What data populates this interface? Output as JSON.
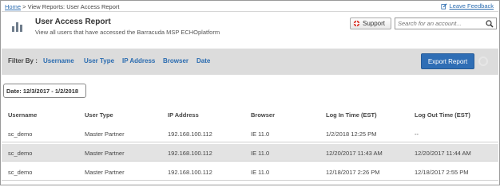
{
  "breadcrumb": {
    "home": "Home",
    "separator": " > ",
    "current": "View Reports: User Access Report"
  },
  "feedback": {
    "label": "Leave Feedback",
    "icon": "edit-icon"
  },
  "header": {
    "icon": "bar-chart-icon",
    "title": "User Access Report",
    "subtitle": "View all users that have accessed the Barracuda MSP ECHOplatform"
  },
  "support": {
    "label": "Support",
    "icon": "lifebuoy-icon"
  },
  "search": {
    "placeholder": "Search for an account...",
    "value": "",
    "icon": "search-icon"
  },
  "filter": {
    "label": "Filter By :",
    "options": [
      "Username",
      "User Type",
      "IP Address",
      "Browser",
      "Date"
    ]
  },
  "export": {
    "label": "Export Report"
  },
  "date_range": {
    "label": "Date: 12/3/2017 - 1/2/2018"
  },
  "table": {
    "columns": [
      "Username",
      "User Type",
      "IP Address",
      "Browser",
      "Log In Time (EST)",
      "Log Out Time (EST)"
    ],
    "rows": [
      [
        "sc_demo",
        "Master Partner",
        "192.168.100.112",
        "IE 11.0",
        "1/2/2018 12:25 PM",
        "--"
      ],
      [
        "sc_demo",
        "Master Partner",
        "192.168.100.112",
        "IE 11.0",
        "12/20/2017 11:43 AM",
        "12/20/2017 11:44 AM"
      ],
      [
        "sc_demo",
        "Master Partner",
        "192.168.100.112",
        "IE 11.0",
        "12/18/2017 2:26 PM",
        "12/18/2017 2:55 PM"
      ]
    ]
  },
  "colors": {
    "link": "#2b6cb0",
    "button": "#2f6eb5",
    "filter_bg": "#dcdcdc",
    "row_shade": "#e3e3e3"
  }
}
